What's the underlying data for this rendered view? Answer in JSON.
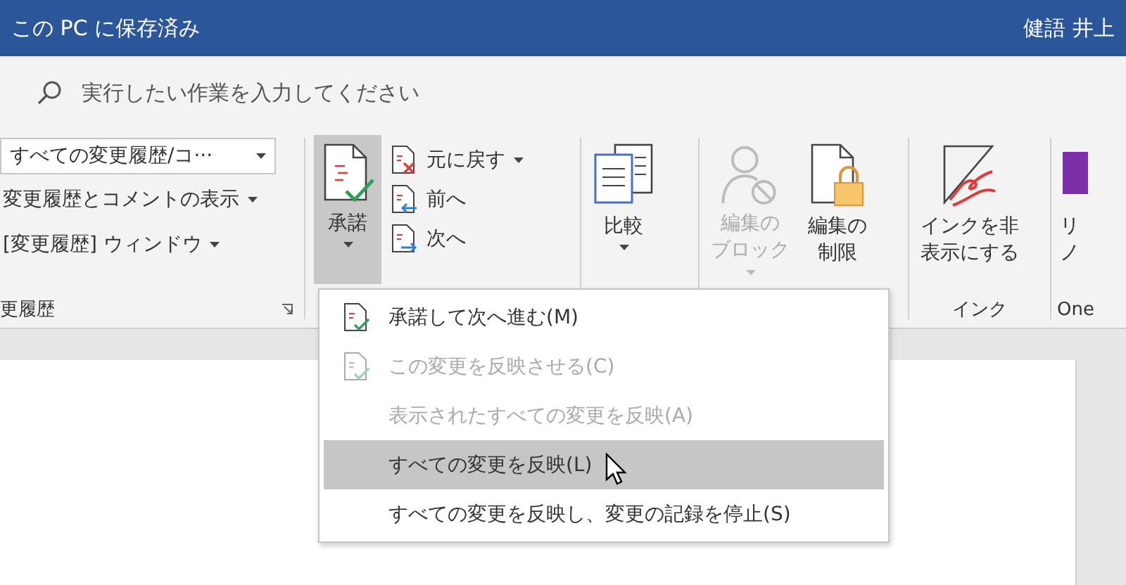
{
  "title_bar": {
    "title": "この PC に保存済み",
    "user": "健語 井上"
  },
  "tell_me": {
    "placeholder": "実行したい作業を入力してください"
  },
  "ribbon": {
    "tracking": {
      "dropdown": "すべての変更履歴/コ···",
      "items": [
        "変更履歴とコメントの表示",
        "[変更履歴] ウィンドウ"
      ],
      "label": "更履歴"
    },
    "changes": {
      "big": {
        "label": "承諾",
        "pressed": true
      },
      "small": [
        {
          "label": "元に戻す",
          "kind": "reject",
          "caret": true
        },
        {
          "label": "前へ",
          "kind": "previous",
          "caret": false
        },
        {
          "label": "次へ",
          "kind": "next",
          "caret": false
        }
      ]
    },
    "compare": {
      "label": "比較"
    },
    "protect": [
      {
        "lines": [
          "編集の",
          "ブロック"
        ],
        "kind": "block",
        "disabled": true,
        "caret": true
      },
      {
        "lines": [
          "編集の",
          "制限"
        ],
        "kind": "restrict",
        "disabled": false,
        "caret": false
      }
    ],
    "ink": {
      "lines": [
        "インクを非",
        "表示にする"
      ],
      "group": "インク"
    },
    "onenote": {
      "lines": [
        "リ",
        "ノ"
      ],
      "group": "One"
    }
  },
  "menu": [
    {
      "label": "承諾して次へ進む(M)",
      "kind": "accept",
      "disabled": false,
      "selected": false
    },
    {
      "label": "この変更を反映させる(C)",
      "kind": "accept",
      "disabled": true,
      "selected": false
    },
    {
      "label": "表示されたすべての変更を反映(A)",
      "kind": "plain",
      "disabled": true,
      "selected": false
    },
    {
      "label": "すべての変更を反映(L)",
      "kind": "plain",
      "disabled": false,
      "selected": true
    },
    {
      "label": "すべての変更を反映し、変更の記録を停止(S)",
      "kind": "plain",
      "disabled": false,
      "selected": false
    }
  ]
}
